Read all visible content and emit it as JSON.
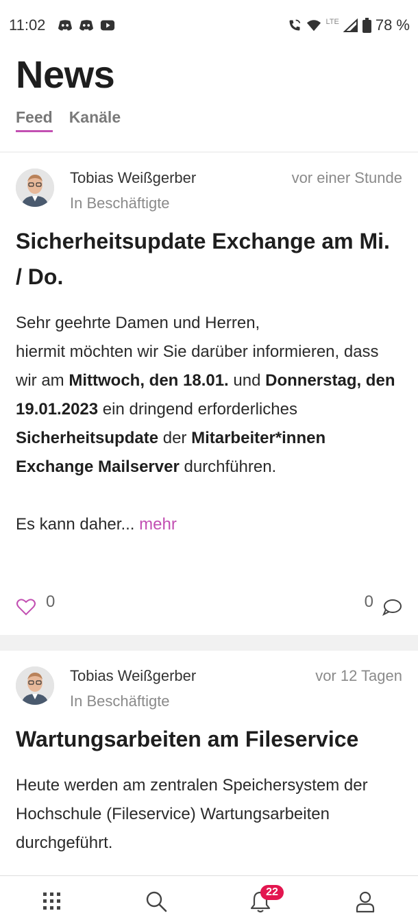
{
  "status_bar": {
    "time": "11:02",
    "battery": "78 %",
    "network": "LTE",
    "left_icons": [
      "discord-icon",
      "discord-icon",
      "youtube-icon"
    ],
    "right_icons": [
      "wifi-call-icon",
      "wifi-icon",
      "signal-icon",
      "battery-icon"
    ]
  },
  "header": {
    "title": "News",
    "tabs": [
      {
        "label": "Feed",
        "active": true
      },
      {
        "label": "Kanäle",
        "active": false
      }
    ]
  },
  "posts": [
    {
      "author": "Tobias Weißgerber",
      "channel": "In Beschäftigte",
      "time": "vor einer Stunde",
      "title": "Sicherheitsupdate Exchange am Mi. / Do.",
      "body": {
        "p1": "Sehr geehrte Damen und Herren,",
        "p2a": "hiermit möchten wir Sie darüber informieren, dass wir am ",
        "b1": "Mittwoch, den 18.01.",
        "p2b": " und ",
        "b2": "Donnerstag, den 19.01.2023",
        "p2c": " ein dringend erforderliches ",
        "b3": "Sicherheitsupdate",
        "p2d": " der ",
        "b4": "Mitarbeiter*innen Exchange Mailserver",
        "p2e": " durchführen.",
        "p3": "Es kann daher...",
        "more": "mehr"
      },
      "likes": "0",
      "comments": "0"
    },
    {
      "author": "Tobias Weißgerber",
      "channel": "In Beschäftigte",
      "time": "vor 12 Tagen",
      "title": "Wartungsarbeiten am Fileservice",
      "body": {
        "p1": "Heute werden am zentralen Speichersystem der Hochschule (Fileservice) Wartungsarbeiten durchgeführt."
      }
    }
  ],
  "bottom_nav": {
    "items": [
      "apps-grid-icon",
      "search-icon",
      "bell-icon",
      "profile-icon"
    ],
    "notification_count": "22"
  },
  "colors": {
    "accent": "#c24fb2",
    "badge": "#e3164f"
  }
}
